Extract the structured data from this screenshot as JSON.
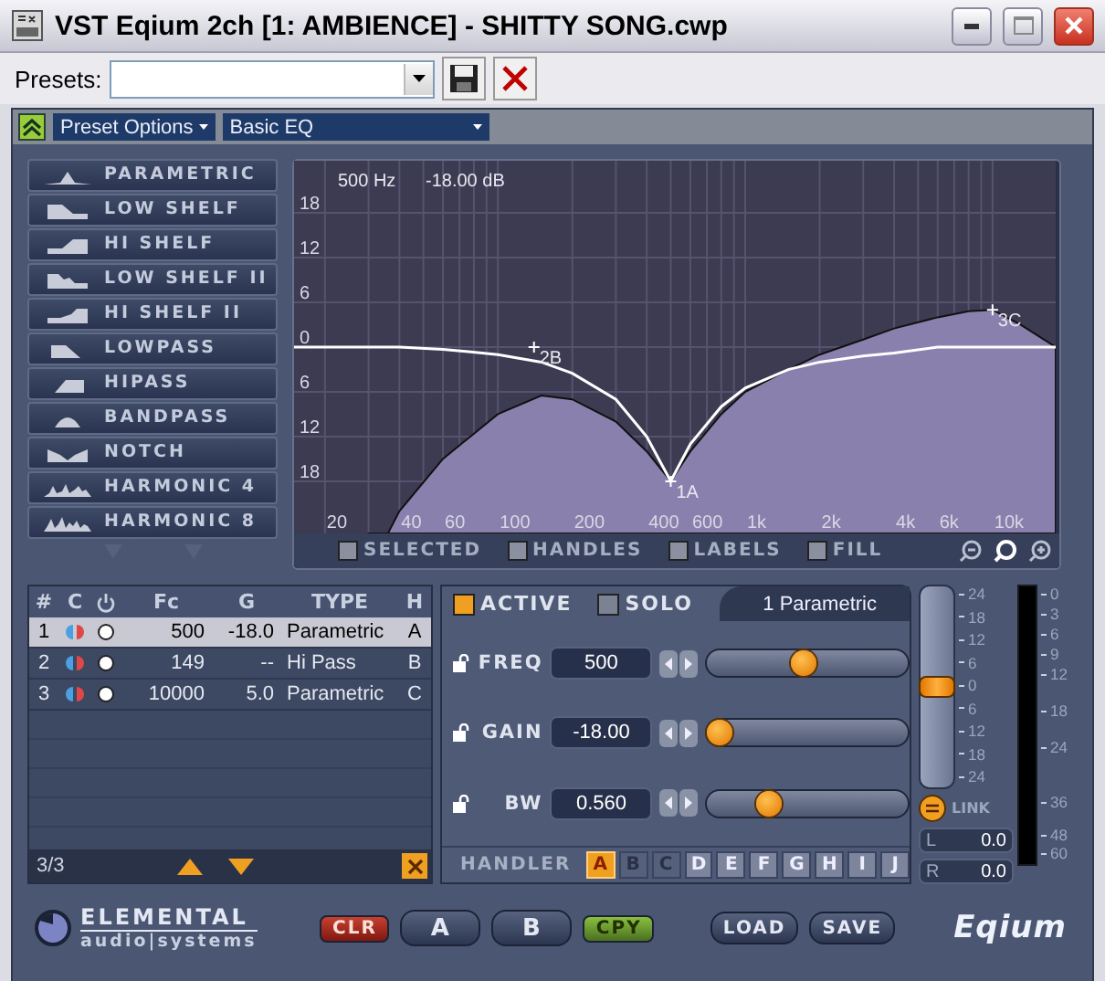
{
  "window": {
    "title": "VST Eqium 2ch [1: AMBIENCE] - SHITTY SONG.cwp"
  },
  "presets": {
    "label": "Presets:"
  },
  "toolbar": {
    "preset_options": "Preset Options",
    "preset_name": "Basic EQ"
  },
  "filter_types": [
    {
      "label": "PARAMETRIC"
    },
    {
      "label": "LOW SHELF"
    },
    {
      "label": "HI SHELF"
    },
    {
      "label": "LOW SHELF II"
    },
    {
      "label": "HI SHELF II"
    },
    {
      "label": "LOWPASS"
    },
    {
      "label": "HIPASS"
    },
    {
      "label": "BANDPASS"
    },
    {
      "label": "NOTCH"
    },
    {
      "label": "HARMONIC 4"
    },
    {
      "label": "HARMONIC 8"
    }
  ],
  "graph": {
    "readout_freq": "500 Hz",
    "readout_gain": "-18.00 dB",
    "y_labels": [
      "18",
      "12",
      "6",
      "0",
      "6",
      "12",
      "18"
    ],
    "x_labels": [
      "20",
      "40",
      "60",
      "100",
      "200",
      "400",
      "600",
      "1k",
      "2k",
      "4k",
      "6k",
      "10k"
    ],
    "handle_labels": [
      "2B",
      "1A",
      "3C"
    ],
    "options": [
      {
        "label": "SELECTED",
        "checked": false
      },
      {
        "label": "HANDLES",
        "checked": false
      },
      {
        "label": "LABELS",
        "checked": false
      },
      {
        "label": "FILL",
        "checked": false
      }
    ]
  },
  "table": {
    "columns": [
      "#",
      "C",
      "Fc",
      "G",
      "TYPE",
      "H"
    ],
    "rows": [
      {
        "num": "1",
        "fc": "500",
        "gain": "-18.0",
        "type": "Parametric",
        "handler": "A",
        "selected": true
      },
      {
        "num": "2",
        "fc": "149",
        "gain": "--",
        "type": "Hi Pass",
        "handler": "B",
        "selected": false
      },
      {
        "num": "3",
        "fc": "10000",
        "gain": "5.0",
        "type": "Parametric",
        "handler": "C",
        "selected": false
      }
    ],
    "count": "3/3"
  },
  "panel": {
    "active": {
      "label": "ACTIVE",
      "checked": true
    },
    "solo": {
      "label": "SOLO",
      "checked": false
    },
    "title": "1 Parametric",
    "params": [
      {
        "label": "FREQ",
        "value": "500",
        "level": 0.46
      },
      {
        "label": "GAIN",
        "value": "-18.00",
        "level": 0
      },
      {
        "label": "BW",
        "value": "0.560",
        "level": 0.27
      }
    ],
    "handler_label": "HANDLER",
    "handlers": [
      {
        "label": "A",
        "selected": true,
        "disabled": false
      },
      {
        "label": "B",
        "selected": false,
        "disabled": true
      },
      {
        "label": "C",
        "selected": false,
        "disabled": true
      },
      {
        "label": "D",
        "selected": false,
        "disabled": false
      },
      {
        "label": "E",
        "selected": false,
        "disabled": false
      },
      {
        "label": "F",
        "selected": false,
        "disabled": false
      },
      {
        "label": "G",
        "selected": false,
        "disabled": false
      },
      {
        "label": "H",
        "selected": false,
        "disabled": false
      },
      {
        "label": "I",
        "selected": false,
        "disabled": false
      },
      {
        "label": "J",
        "selected": false,
        "disabled": false
      }
    ]
  },
  "output": {
    "fader": {
      "level": 0.5,
      "scale": [
        "24",
        "18",
        "12",
        "6",
        "0",
        "6",
        "12",
        "18",
        "24"
      ]
    },
    "link": "LINK",
    "left": {
      "label": "L",
      "value": "0.0"
    },
    "right": {
      "label": "R",
      "value": "0.0"
    },
    "meter_scale": [
      "0",
      "3",
      "6",
      "9",
      "12",
      "18",
      "24",
      "36",
      "48",
      "60"
    ]
  },
  "footer": {
    "logo_top": "ELEMENTAL",
    "logo_bottom": "audio|systems",
    "clr": "CLR",
    "a": "A",
    "b": "B",
    "cpy": "CPY",
    "load": "LOAD",
    "save": "SAVE",
    "product": "Eqium"
  }
}
